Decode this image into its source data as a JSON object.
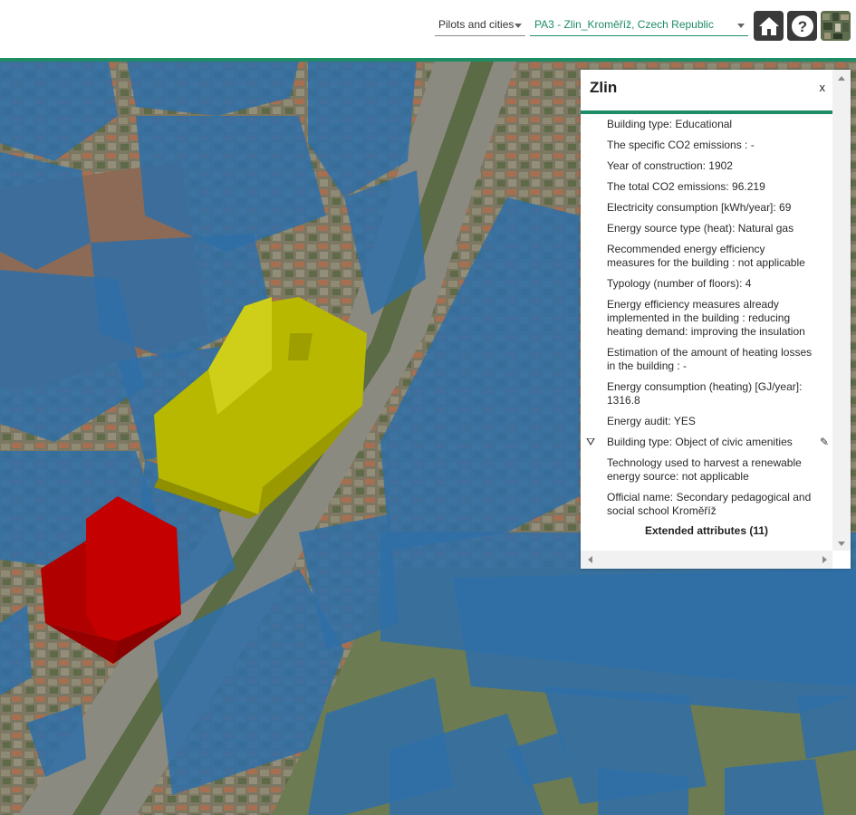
{
  "header": {
    "pilots_select": {
      "value": "Pilots and cities"
    },
    "city_select": {
      "value": "PA3 - Zlin_Kroměříž, Czech Republic"
    },
    "buttons": [
      {
        "name": "home",
        "icon": "home-icon"
      },
      {
        "name": "help",
        "icon": "help-icon",
        "glyph": "?"
      },
      {
        "name": "basemap",
        "icon": "basemap-thumbnail-icon"
      }
    ],
    "accent_color": "#1e8c64"
  },
  "map": {
    "building_colors": {
      "generic": "#2f6fa8",
      "selected": "#b8b800",
      "highlighted": "#b00000"
    }
  },
  "panel": {
    "title": "Zlin",
    "close_label": "x",
    "attributes": [
      {
        "text": "Building type: Educational"
      },
      {
        "text": "The specific CO2 emissions : -"
      },
      {
        "text": "Year of construction: 1902"
      },
      {
        "text": "The total CO2 emissions: 96.219"
      },
      {
        "text": "Electricity consumption [kWh/year]: 69"
      },
      {
        "text": "Energy source type (heat): Natural gas"
      },
      {
        "text": "Recommended energy efficiency measures for the building : not applicable"
      },
      {
        "text": "Typology (number of floors): 4"
      },
      {
        "text": "Energy efficiency measures already implemented in the building : reducing heating demand: improving the insulation"
      },
      {
        "text": "Estimation of the amount of heating losses in the building : -"
      },
      {
        "text": "Energy consumption (heating) [GJ/year]: 1316.8"
      },
      {
        "text": "Energy audit: YES"
      },
      {
        "text": "Building type: Object of civic amenities"
      },
      {
        "text": "Technology used to harvest a renewable energy source: not applicable"
      },
      {
        "text": "Official name: Secondary pedagogical and social school Kroměříž"
      }
    ],
    "extended_link": "Extended attributes (11)"
  }
}
